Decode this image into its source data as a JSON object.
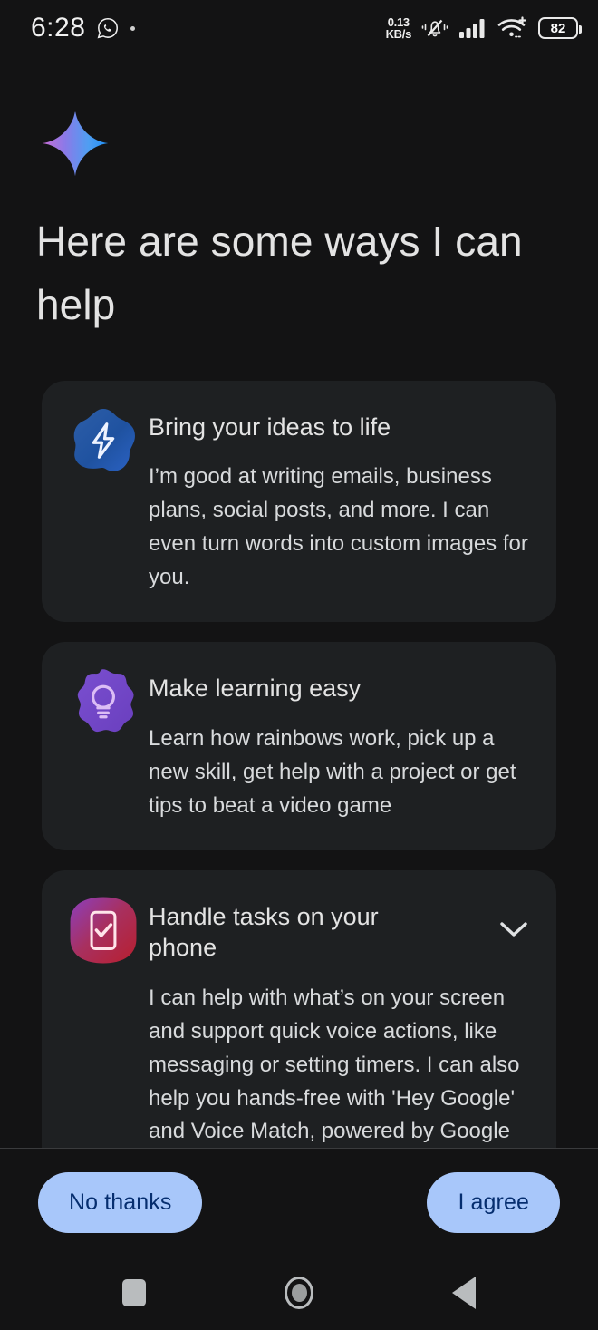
{
  "status_bar": {
    "clock": "6:28",
    "app_icon": "whatsapp-icon",
    "network_speed_value": "0.13",
    "network_speed_unit": "KB/s",
    "ring_mode_icon": "bell-muted-vibrate-icon",
    "signal_icon": "cellular-signal-icon",
    "wifi_icon": "wifi-plus-icon",
    "battery_level": "82"
  },
  "header": {
    "logo_icon": "gemini-sparkle-icon",
    "title": "Here are some ways I can help"
  },
  "cards": [
    {
      "icon": "lightning-bolt-blob-icon",
      "title": "Bring your ideas to life",
      "description": "I’m good at writing emails, business plans, social posts, and more. I can even turn words into custom images for you.",
      "expandable": false
    },
    {
      "icon": "lightbulb-flower-icon",
      "title": "Make learning easy",
      "description": "Learn how rainbows work, pick up a new skill, get help with a project or get tips to beat a video game",
      "expandable": false
    },
    {
      "icon": "phone-check-icon",
      "title": "Handle tasks on your phone",
      "description": "I can help with what’s on your screen and support quick voice actions, like messaging or setting timers. I can also help you hands-free with 'Hey Google' and Voice Match, powered by Google Assistant. If you opt in, I’ll replace Google Assistant.",
      "expandable": true,
      "expand_icon": "chevron-down-icon"
    }
  ],
  "actions": {
    "decline_label": "No thanks",
    "accept_label": "I agree"
  },
  "navigation_bar": {
    "recents_icon": "recents-square-icon",
    "home_icon": "home-circle-icon",
    "back_icon": "back-triangle-icon"
  },
  "colors": {
    "page_background": "#131314",
    "card_background": "#1e2022",
    "button_fill": "#a8c7fa",
    "button_text": "#062e6f",
    "primary_text": "#e3e3e3"
  }
}
